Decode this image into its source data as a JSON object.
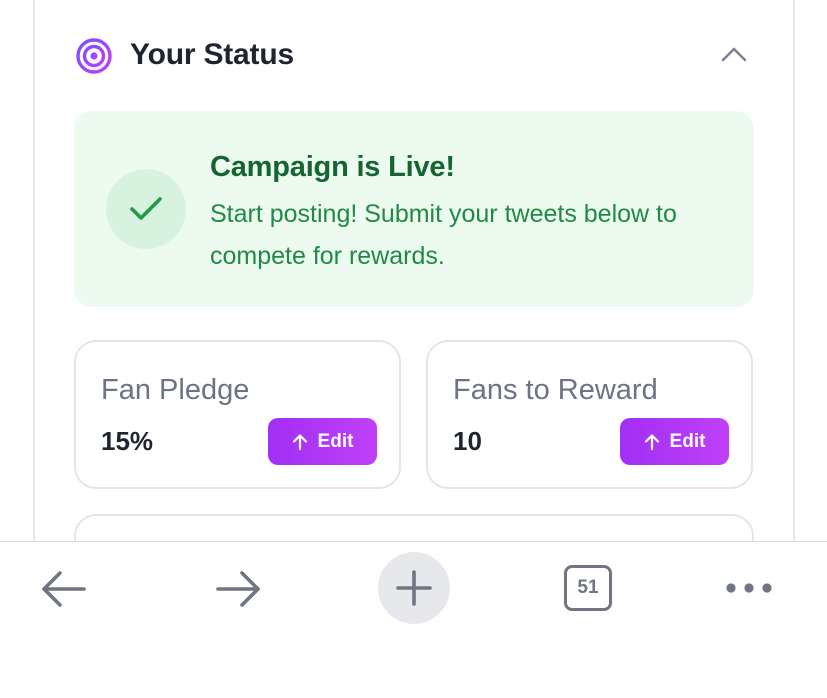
{
  "status_section": {
    "title": "Your Status",
    "icon": "target-icon",
    "collapse_icon": "chevron-up-icon"
  },
  "live_banner": {
    "title": "Campaign is Live!",
    "description": "Start posting! Submit your tweets below to compete for rewards.",
    "icon": "check-icon",
    "accent_color": "#14652f",
    "background_color": "#ecfaf0"
  },
  "stats": [
    {
      "label": "Fan Pledge",
      "value": "15%",
      "button_label": "Edit",
      "button_icon": "arrow-up-icon"
    },
    {
      "label": "Fans to Reward",
      "value": "10",
      "button_label": "Edit",
      "button_icon": "arrow-up-icon"
    }
  ],
  "colors": {
    "brand_purple": "#a12ff5",
    "text_dark": "#1f2530",
    "text_muted": "#6b7384"
  },
  "browser_toolbar": {
    "back_icon": "arrow-left-icon",
    "forward_icon": "arrow-right-icon",
    "new_tab_icon": "plus-icon",
    "tab_count": "51",
    "more_icon": "more-dots-icon"
  }
}
